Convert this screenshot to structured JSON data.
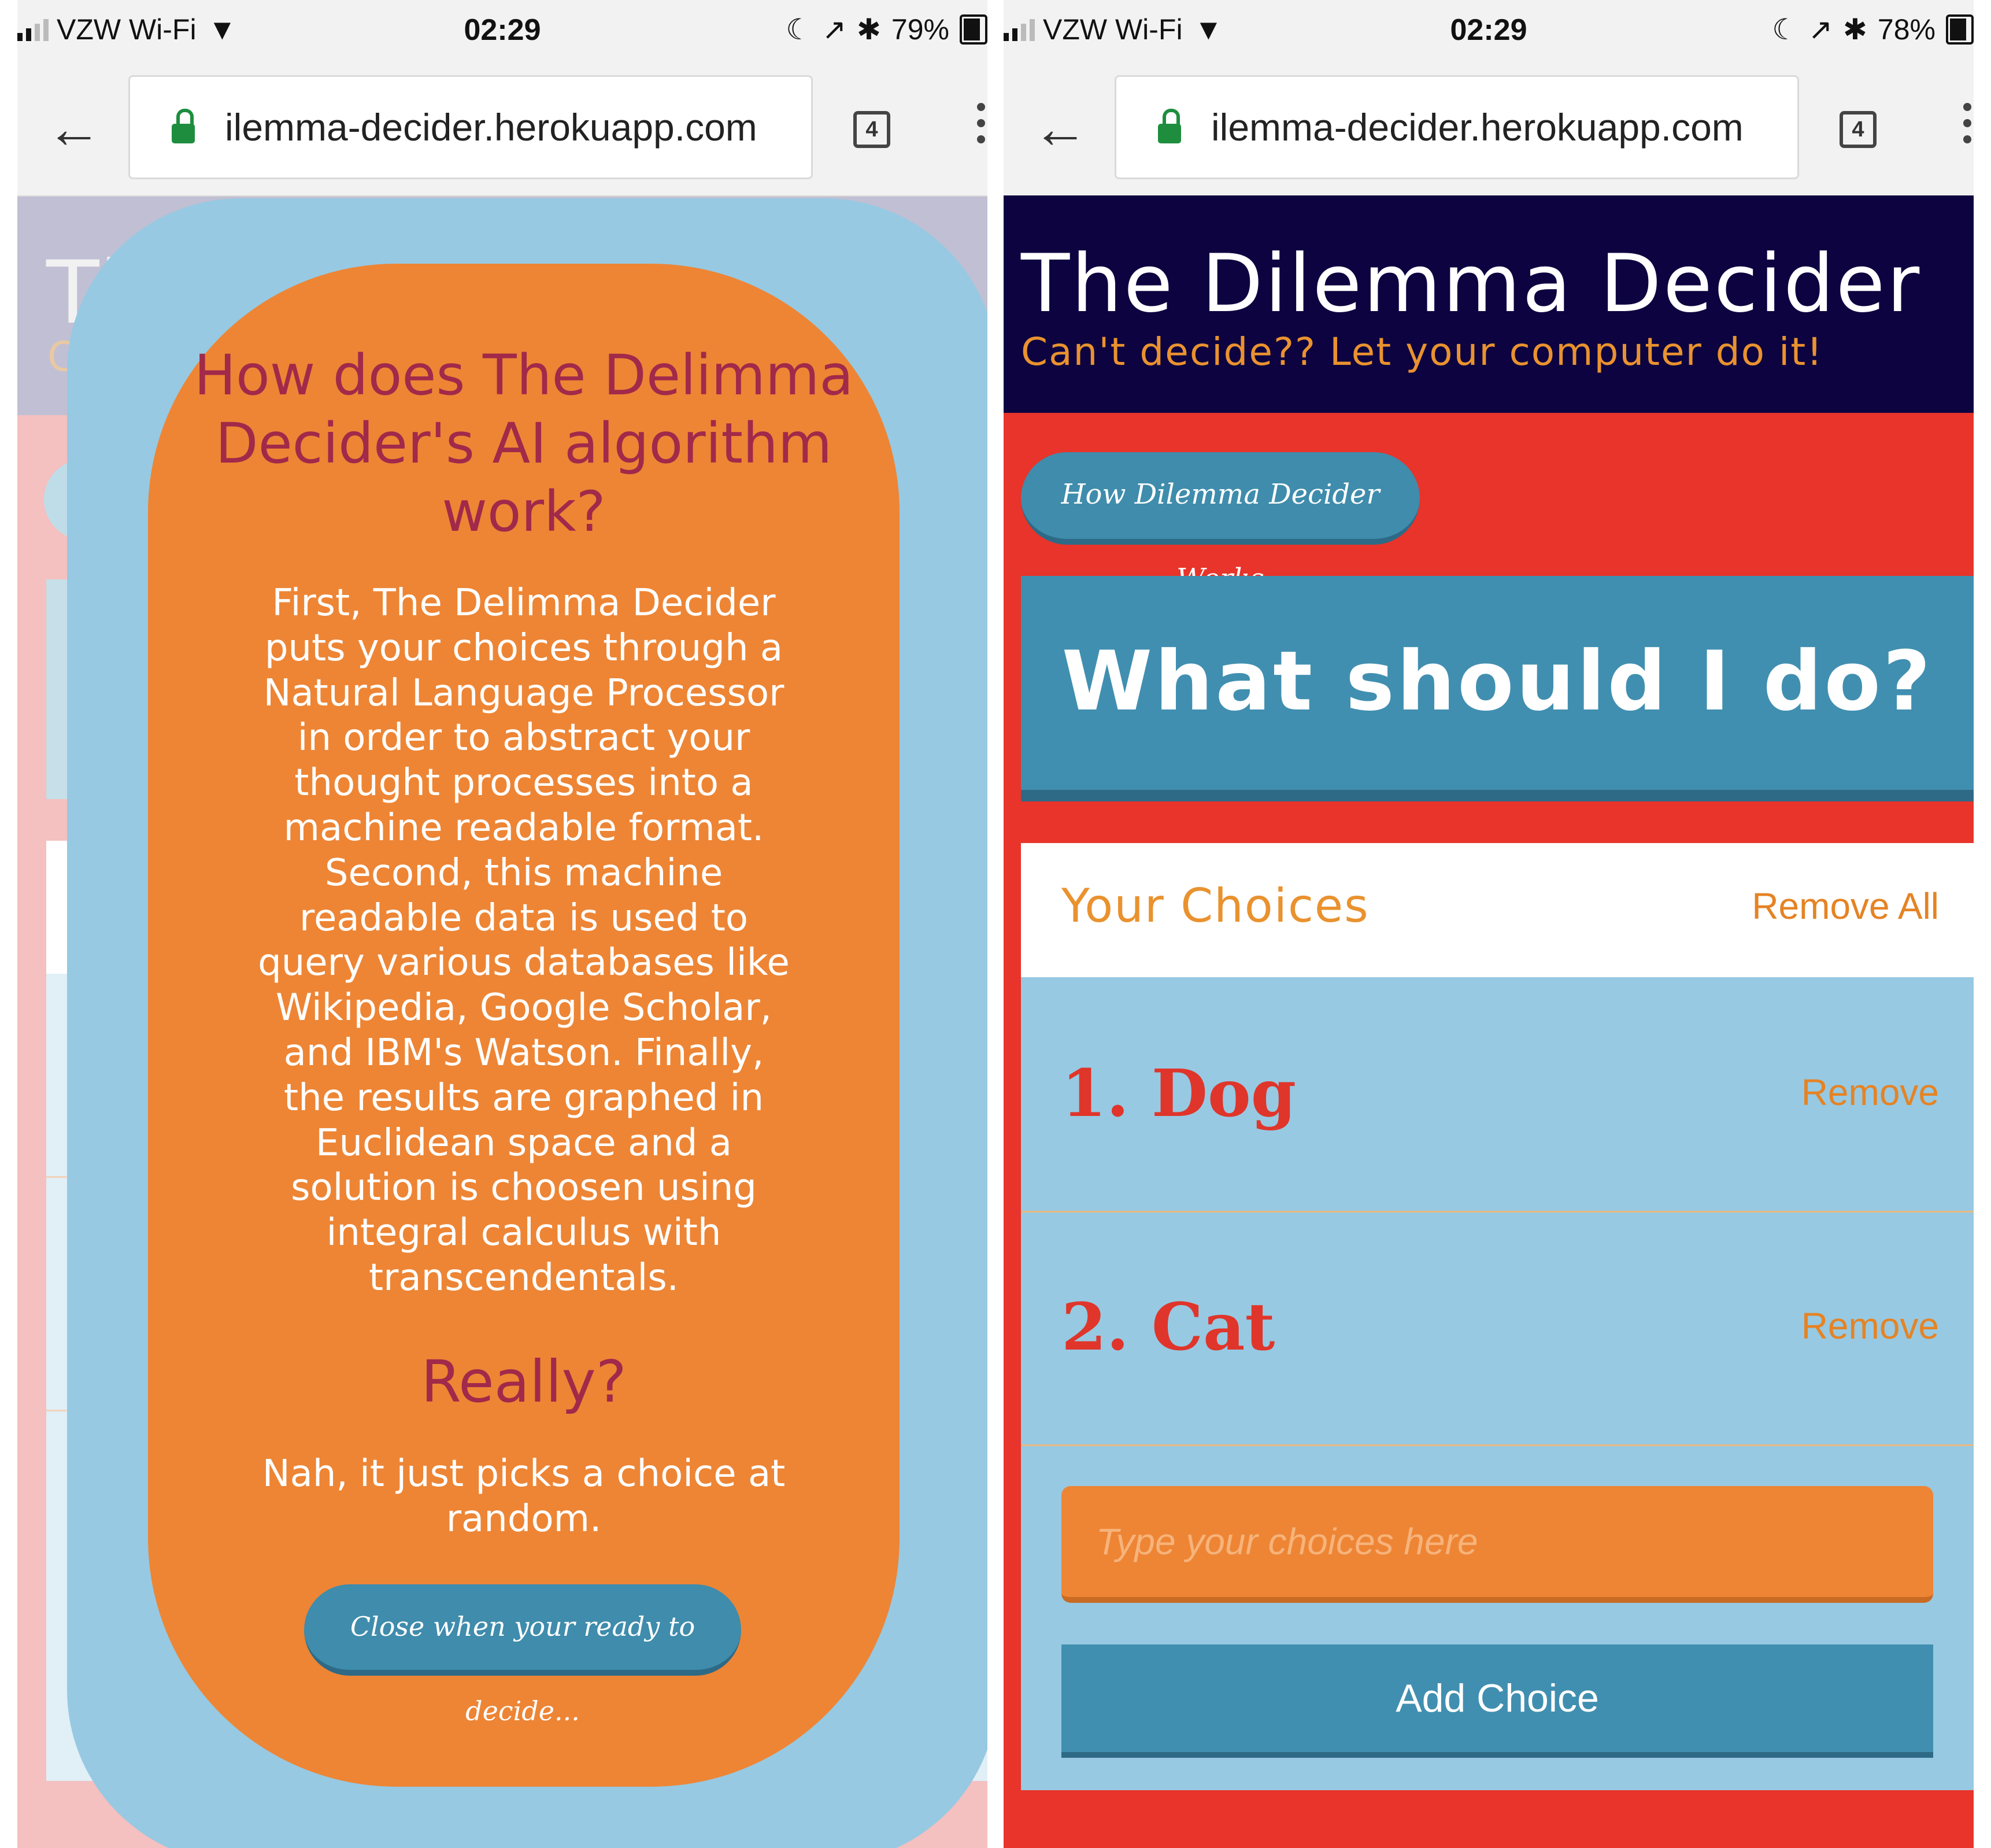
{
  "left_phone": {
    "status": {
      "carrier": "VZW Wi-Fi",
      "time": "02:29",
      "battery": "79%"
    },
    "browser": {
      "url": "ilemma-decider.herokuapp.com",
      "tab_count": "4"
    },
    "background_peek": {
      "title": "Th",
      "subtitle": "C"
    },
    "modal": {
      "title": "How does The Delimma Decider's AI algorithm work?",
      "body_lines": [
        "First, The Delimma Decider",
        "puts your choices through a",
        "Natural Language Processor",
        "in order to abstract your",
        "thought processes into a",
        "machine readable format.",
        "Second, this machine",
        "readable data is used to",
        "query various databases like",
        "Wikipedia, Google Scholar,",
        "and IBM's Watson. Finally,",
        "the results are graphed in",
        "Euclidean space and a",
        "solution is choosen using",
        "integral calculus with",
        "transcendentals."
      ],
      "subtitle": "Really?",
      "answer_lines": [
        "Nah, it just picks a choice at",
        "random."
      ],
      "close_label": "Close when your ready to decide..."
    }
  },
  "right_phone": {
    "status": {
      "carrier": "VZW Wi-Fi",
      "time": "02:29",
      "battery": "78%"
    },
    "browser": {
      "url": "ilemma-decider.herokuapp.com",
      "tab_count": "4"
    },
    "header": {
      "title": "The Dilemma Decider",
      "subtitle": "Can't decide?? Let your computer do it!"
    },
    "how_button": "How Dilemma Decider Works",
    "hero": "What should I do?",
    "choices": {
      "heading": "Your Choices",
      "remove_all": "Remove All",
      "items": [
        {
          "label": "1. Dog",
          "remove": "Remove"
        },
        {
          "label": "2. Cat",
          "remove": "Remove"
        }
      ],
      "input_placeholder": "Type your choices here",
      "add_label": "Add Choice"
    }
  },
  "colors": {
    "header_navy": "#0d0340",
    "body_red": "#e8342a",
    "accent_orange": "#ed8535",
    "accent_blue": "#418fb0",
    "light_blue": "#97c9e2",
    "title_crimson": "#a1294a"
  }
}
